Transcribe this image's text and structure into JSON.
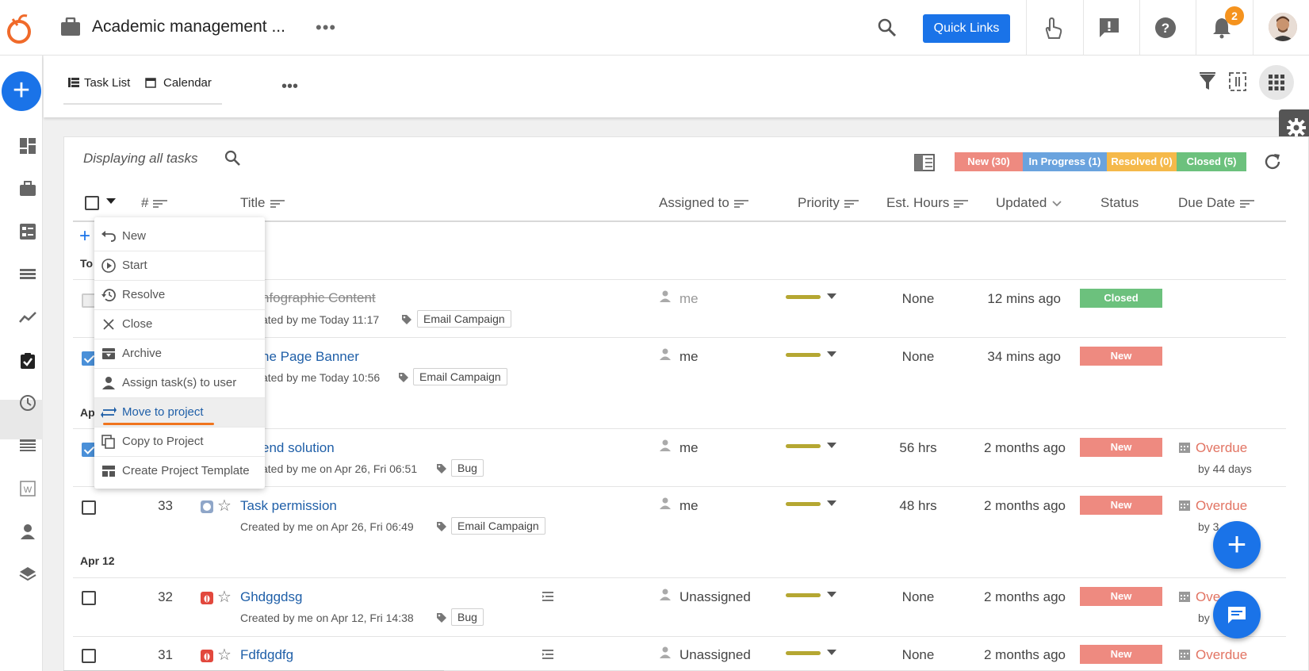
{
  "topbar": {
    "app_title": "Academic management ...",
    "more": "•••",
    "quick_links": "Quick Links",
    "notification_count": "2",
    "accent": "#1a73e8"
  },
  "subbar": {
    "tabs": [
      {
        "label": "Task List",
        "icon": "list-icon"
      },
      {
        "label": "Calendar",
        "icon": "calendar-icon"
      }
    ],
    "more": "•••"
  },
  "panel": {
    "displaying": "Displaying all tasks",
    "status_pills": [
      {
        "label": "New (30)",
        "color": "#ee8a80"
      },
      {
        "label": "In Progress (1)",
        "color": "#6aa3de"
      },
      {
        "label": "Resolved (0)",
        "color": "#f5b94a"
      },
      {
        "label": "Closed (5)",
        "color": "#6cc17d"
      }
    ]
  },
  "table": {
    "columns": [
      "#",
      "Title",
      "Assigned to",
      "Priority",
      "Est. Hours",
      "Updated",
      "Status",
      "Due Date"
    ],
    "groups": [
      "To",
      "Ap",
      "Apr 12"
    ],
    "rows": [
      {
        "num": "",
        "title": "nfographic Content",
        "sub": "ated by me Today 11:17",
        "tag": "Email Campaign",
        "assigned": "me",
        "est": "None",
        "updated": "12 mins ago",
        "status": "Closed",
        "due": "",
        "due_sub": ""
      },
      {
        "num": "",
        "title": "ne Page Banner",
        "sub": "ated by me Today 10:56",
        "tag": "Email Campaign",
        "assigned": "me",
        "est": "None",
        "updated": "34 mins ago",
        "status": "New",
        "due": "",
        "due_sub": ""
      },
      {
        "num": "",
        "title": "end solution",
        "sub": "ated by me on Apr 26, Fri 06:51",
        "tag": "Bug",
        "assigned": "me",
        "est": "56 hrs",
        "updated": "2 months ago",
        "status": "New",
        "due": "Overdue",
        "due_sub": "by 44 days"
      },
      {
        "num": "33",
        "title": "Task permission",
        "sub": "Created by me on Apr 26, Fri 06:49",
        "tag": "Email Campaign",
        "assigned": "me",
        "est": "48 hrs",
        "updated": "2 months ago",
        "status": "New",
        "due": "Overdue",
        "due_sub": "by 3"
      },
      {
        "num": "32",
        "title": "Ghdggdsg",
        "sub": "Created by me on Apr 12, Fri 14:38",
        "tag": "Bug",
        "assigned": "Unassigned",
        "est": "None",
        "updated": "2 months ago",
        "status": "New",
        "due": "Ove",
        "due_sub": "by"
      },
      {
        "num": "31",
        "title": "Fdfdgdfg",
        "sub": "",
        "tag": "",
        "assigned": "Unassigned",
        "est": "None",
        "updated": "2 months ago",
        "status": "New",
        "due": "Overdue",
        "due_sub": ""
      }
    ]
  },
  "menu": {
    "items": [
      {
        "label": "New",
        "icon": "undo-icon"
      },
      {
        "label": "Start",
        "icon": "play-circle-icon"
      },
      {
        "label": "Resolve",
        "icon": "history-icon"
      },
      {
        "label": "Close",
        "icon": "close-icon"
      },
      {
        "label": "Archive",
        "icon": "archive-icon"
      },
      {
        "label": "Assign task(s) to user",
        "icon": "person-icon"
      },
      {
        "label": "Move to project",
        "icon": "swap-icon"
      },
      {
        "label": "Copy to Project",
        "icon": "copy-icon"
      },
      {
        "label": "Create Project Template",
        "icon": "template-icon"
      }
    ],
    "highlighted": "Move to project"
  }
}
